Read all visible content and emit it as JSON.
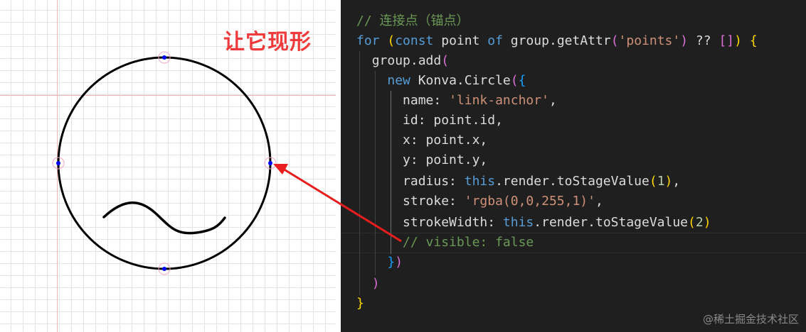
{
  "canvas": {
    "annotation_text": "让它现形",
    "colors": {
      "annotation": "#ef3b3b",
      "anchor_dot": "#0000ff",
      "anchor_ring": "#f4a6c8",
      "arrow": "#e81e1e"
    }
  },
  "code": {
    "line1": {
      "comment": "// 连接点（锚点）"
    },
    "line2": {
      "kw_for": "for",
      "open_paren": "(",
      "kw_const": "const",
      "var_point": "point",
      "kw_of": "of",
      "expr": "group.getAttr",
      "paren_open": "(",
      "str_points": "'points'",
      "paren_close": ")",
      "op_nullish": "??",
      "arr": "[]",
      "close_paren": ")",
      "brace": "{"
    },
    "line3": {
      "call": "group.add",
      "paren": "("
    },
    "line4": {
      "kw_new": "new",
      "ctor": "Konva.Circle",
      "paren": "(",
      "brace": "{"
    },
    "line5": {
      "key": "name: ",
      "value": "'link-anchor'",
      "comma": ","
    },
    "line6": {
      "text": "id: point.id,"
    },
    "line7": {
      "text": "x: point.x,"
    },
    "line8": {
      "text": "y: point.y,"
    },
    "line9": {
      "key": "radius: ",
      "kw_this": "this",
      "rest": ".render.toStageValue",
      "paren_open": "(",
      "num": "1",
      "paren_close": ")",
      "comma": ","
    },
    "line10": {
      "key": "stroke: ",
      "value": "'rgba(0,0,255,1)'",
      "comma": ","
    },
    "line11": {
      "key": "strokeWidth: ",
      "kw_this": "this",
      "rest": ".render.toStageValue",
      "paren_open": "(",
      "num": "2",
      "paren_close": ")"
    },
    "line12": {
      "comment": "// visible: false"
    },
    "line13": {
      "brace": "}",
      "paren": ")"
    },
    "line14": {
      "paren": ")"
    },
    "line15": {
      "brace": "}"
    }
  },
  "watermark": "@稀土掘金技术社区"
}
